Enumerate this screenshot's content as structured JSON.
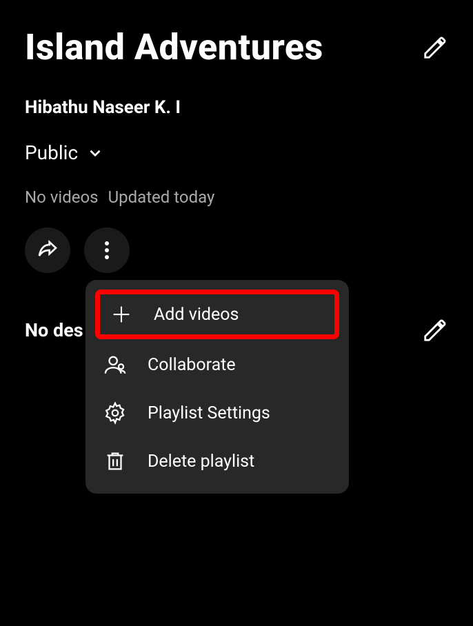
{
  "playlist": {
    "title": "Island Adventures",
    "channel": "Hibathu Naseer K. I",
    "visibility": "Public",
    "stats": {
      "videos": "No videos",
      "updated": "Updated today"
    },
    "description": "No des"
  },
  "menu": {
    "add_videos": "Add videos",
    "collaborate": "Collaborate",
    "playlist_settings": "Playlist Settings",
    "delete_playlist": "Delete playlist"
  }
}
